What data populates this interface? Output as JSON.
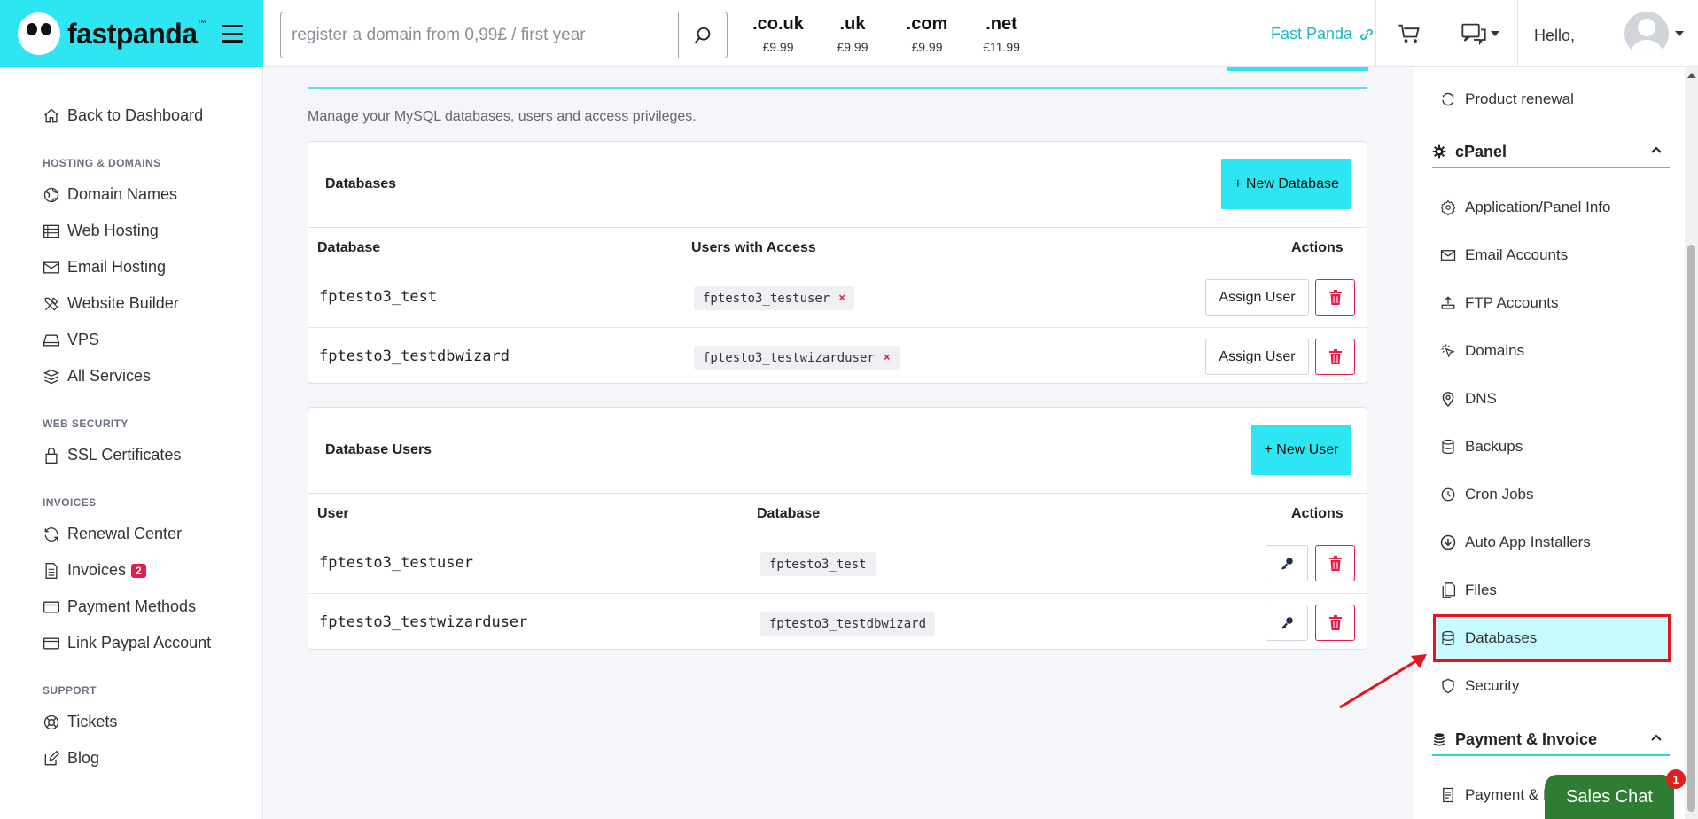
{
  "brand": {
    "name": "fastpanda",
    "tm": "™"
  },
  "search": {
    "placeholder": "register a domain from 0,99£ / first year"
  },
  "tlds": [
    {
      "ext": ".co.uk",
      "price": "£9.99"
    },
    {
      "ext": ".uk",
      "price": "£9.99"
    },
    {
      "ext": ".com",
      "price": "£9.99"
    },
    {
      "ext": ".net",
      "price": "£11.99"
    }
  ],
  "header": {
    "user_link": "Fast Panda",
    "greeting": "Hello,"
  },
  "sidebar": {
    "back": "Back to Dashboard",
    "sections": [
      {
        "head": "HOSTING & DOMAINS",
        "items": [
          "Domain Names",
          "Web Hosting",
          "Email Hosting",
          "Website Builder",
          "VPS",
          "All Services"
        ]
      },
      {
        "head": "WEB SECURITY",
        "items": [
          "SSL Certificates"
        ]
      },
      {
        "head": "INVOICES",
        "items": [
          "Renewal Center",
          "Invoices",
          "Payment Methods",
          "Link Paypal Account"
        ]
      },
      {
        "head": "SUPPORT",
        "items": [
          "Tickets",
          "Blog"
        ]
      }
    ],
    "invoice_badge": "2"
  },
  "main": {
    "subtitle": "Manage your MySQL databases, users and access privileges.",
    "databases": {
      "title": "Databases",
      "add_label": "+ New Database",
      "columns": [
        "Database",
        "Users with Access",
        "Actions"
      ],
      "rows": [
        {
          "name": "fptesto3_test",
          "user": "fptesto3_testuser"
        },
        {
          "name": "fptesto3_testdbwizard",
          "user": "fptesto3_testwizarduser"
        }
      ],
      "assign_label": "Assign User"
    },
    "users": {
      "title": "Database Users",
      "add_label": "+ New User",
      "columns": [
        "User",
        "Database",
        "Actions"
      ],
      "rows": [
        {
          "name": "fptesto3_testuser",
          "db": "fptesto3_test"
        },
        {
          "name": "fptesto3_testwizarduser",
          "db": "fptesto3_testdbwizard"
        }
      ]
    }
  },
  "right_panel": {
    "product_renewal": "Product renewal",
    "cpanel_head": "cPanel",
    "items": [
      "Application/Panel Info",
      "Email Accounts",
      "FTP Accounts",
      "Domains",
      "DNS",
      "Backups",
      "Cron Jobs",
      "Auto App Installers",
      "Files",
      "Databases",
      "Security"
    ],
    "payment_head": "Payment & Invoice",
    "payment_item": "Payment & I"
  },
  "chat": {
    "label": "Sales Chat",
    "badge": "1"
  },
  "colors": {
    "accent": "#2de6f2",
    "danger": "#e11d48",
    "highlight": "#e3141b",
    "chat": "#2e7d32"
  }
}
